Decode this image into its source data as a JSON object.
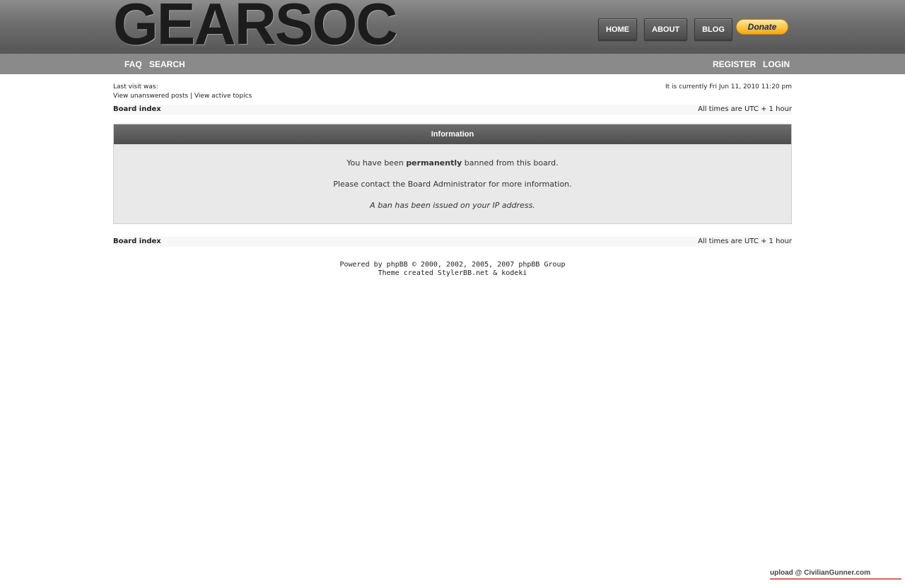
{
  "header": {
    "logo": "GEARSOC",
    "nav": [
      {
        "label": "HOME"
      },
      {
        "label": "ABOUT"
      },
      {
        "label": "BLOG"
      }
    ],
    "donate_label": "Donate"
  },
  "subnav": {
    "left": [
      {
        "label": "FAQ"
      },
      {
        "label": "SEARCH"
      }
    ],
    "right": [
      {
        "label": "REGISTER"
      },
      {
        "label": "LOGIN"
      }
    ]
  },
  "info": {
    "last_visit": "Last visit was:",
    "unanswered_link": "View unanswered posts",
    "separator": "|",
    "active_link": "View active topics",
    "current_time": "It is currently Fri Jun 11, 2010 11:20 pm"
  },
  "breadcrumb": {
    "board_index": "Board index",
    "timezone": "All times are UTC + 1 hour"
  },
  "panel": {
    "title": "Information",
    "msg1_pre": "You have been",
    "msg1_bold": "permanently",
    "msg1_post": "banned from this board.",
    "msg2": "Please contact the Board Administrator for more information.",
    "msg3": "A ban has been issued on your IP address."
  },
  "footer": {
    "line1": "Powered by phpBB © 2000, 2002, 2005, 2007 phpBB Group",
    "line2": "Theme created StylerBB.net & kodeki"
  },
  "watermark": "upload @ CivilianGunner.com"
}
